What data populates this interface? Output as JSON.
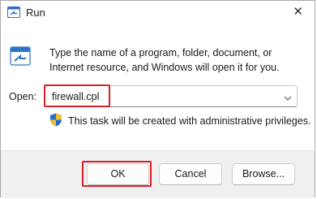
{
  "window": {
    "title": "Run",
    "close_glyph": "✕"
  },
  "prompt": {
    "description": "Type the name of a program, folder, document, or Internet resource, and Windows will open it for you."
  },
  "open_field": {
    "label": "Open:",
    "value": "firewall.cpl"
  },
  "admin_note": {
    "text": "This task will be created with administrative privileges."
  },
  "buttons": {
    "ok": "OK",
    "cancel": "Cancel",
    "browse": "Browse..."
  },
  "colors": {
    "highlight": "#d9202a",
    "footer_bg": "#f0f0f0",
    "shield_blue": "#1f6fd1",
    "shield_yellow": "#f2c029"
  },
  "icons": [
    "run-app-icon",
    "run-dialog-icon",
    "chevron-down-icon",
    "uac-shield-icon",
    "close-icon"
  ]
}
